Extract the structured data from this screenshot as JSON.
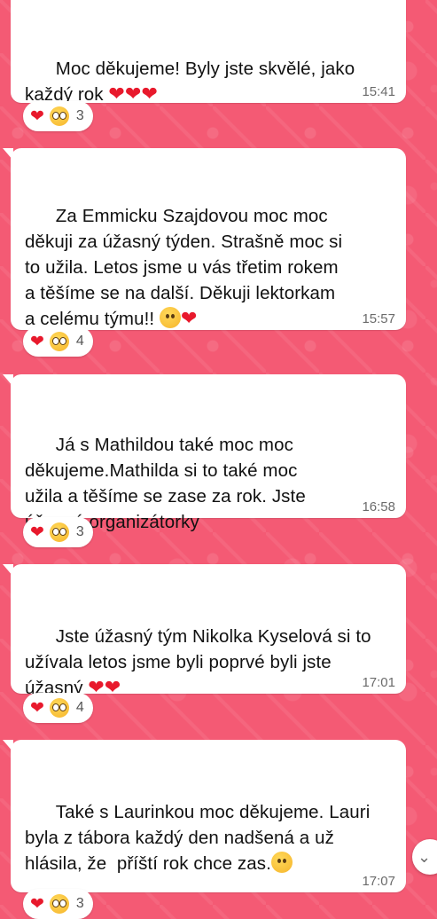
{
  "messages": [
    {
      "text": "Moc děkujeme! Byly jste skvělé, jako\nkaždý rok ",
      "emoji_suffix": "❤❤❤",
      "time": "15:41",
      "reactions": {
        "heart": "❤",
        "face": "pleading-face",
        "count": "3"
      }
    },
    {
      "text": "Za Emmicku Szajdovou moc moc\nděkuji za úžasný týden. Strašně moc si\nto užila. Letos jsme u vás třetim rokem\na těšíme se na další. Děkuji lektorkam\na celému týmu!! ",
      "emoji_suffix": "❤",
      "emoji_prefix_icon": "partying-face",
      "time": "15:57",
      "reactions": {
        "heart": "❤",
        "face": "pleading-face",
        "count": "4"
      }
    },
    {
      "text": "Já s Mathildou také moc moc\nděkujeme.Mathilda si to také moc\nužila a těšíme se zase za rok. Jste\núžasné organizátorky",
      "time": "16:58",
      "reactions": {
        "heart": "❤",
        "face": "pleading-face",
        "count": "3"
      }
    },
    {
      "text": "Jste úžasný tým Nikolka Kyselová si to\nužívala letos jsme byli poprvé byli jste\núžasný ",
      "emoji_suffix": "❤❤",
      "time": "17:01",
      "reactions": {
        "heart": "❤",
        "face": "pleading-face",
        "count": "4"
      }
    },
    {
      "text": "Také s Laurinkou moc děkujeme. Lauri\nbyla z tábora každý den nadšená a už\nhlásila, že  příští rok chce zas.",
      "emoji_suffix_icon": "smiling-face-with-hearts",
      "time": "17:07",
      "reactions": {
        "heart": "❤",
        "face": "pleading-face",
        "count": "3"
      }
    }
  ],
  "scroll_button": {
    "icon": "double-chevron-down-icon",
    "glyph": "⌄"
  },
  "colors": {
    "wallpaper": "#f45a74",
    "bubble": "#ffffff",
    "heart": "#e8192c",
    "timestamp": "#6b6b6b"
  }
}
